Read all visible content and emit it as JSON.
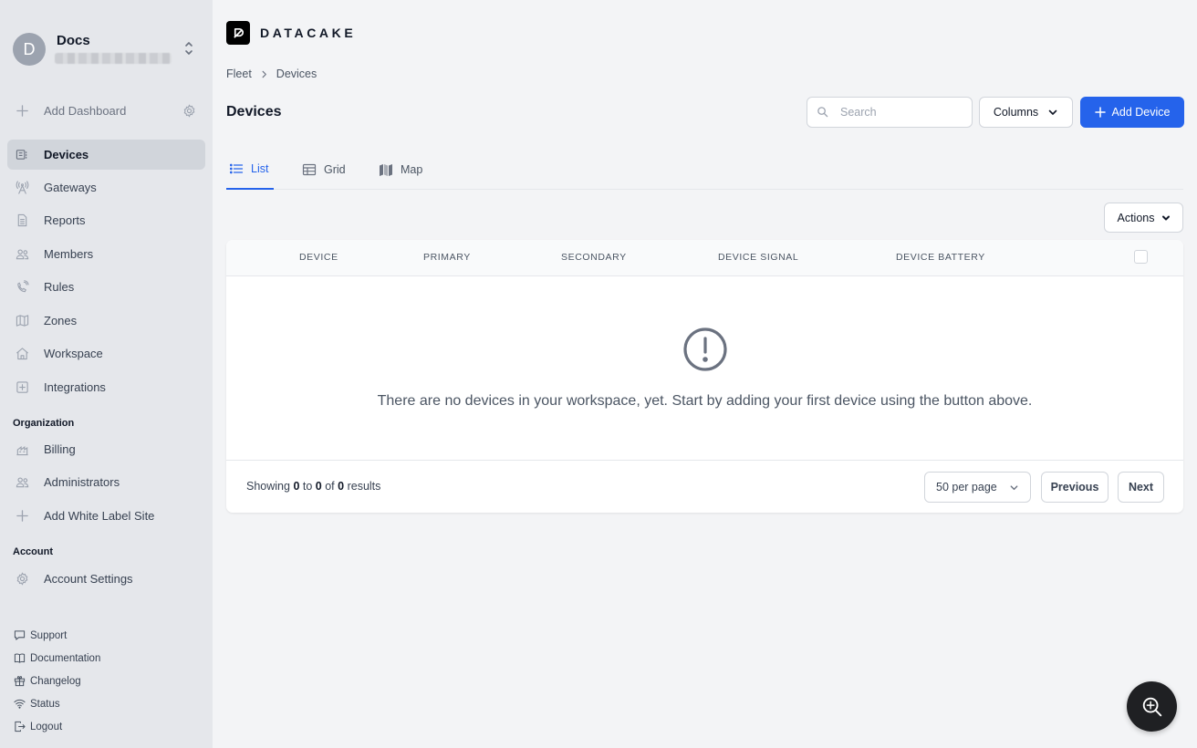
{
  "workspace": {
    "avatar_letter": "D",
    "name": "Docs"
  },
  "sidebar": {
    "add_dashboard": "Add Dashboard",
    "items": [
      {
        "label": "Devices",
        "icon": "device-icon"
      },
      {
        "label": "Gateways",
        "icon": "antenna-icon"
      },
      {
        "label": "Reports",
        "icon": "document-icon"
      },
      {
        "label": "Members",
        "icon": "users-icon"
      },
      {
        "label": "Rules",
        "icon": "phone-signal-icon"
      },
      {
        "label": "Zones",
        "icon": "map-icon"
      },
      {
        "label": "Workspace",
        "icon": "house-icon"
      },
      {
        "label": "Integrations",
        "icon": "plus-square-icon"
      }
    ],
    "organization_title": "Organization",
    "organization_items": [
      {
        "label": "Billing",
        "icon": "billing-icon"
      },
      {
        "label": "Administrators",
        "icon": "users-icon"
      },
      {
        "label": "Add White Label Site",
        "icon": "plus-icon"
      }
    ],
    "account_title": "Account",
    "account_items": [
      {
        "label": "Account Settings",
        "icon": "gear-icon"
      }
    ],
    "footer": [
      {
        "label": "Support",
        "icon": "chat-icon"
      },
      {
        "label": "Documentation",
        "icon": "book-icon"
      },
      {
        "label": "Changelog",
        "icon": "gift-icon"
      },
      {
        "label": "Status",
        "icon": "wifi-icon"
      },
      {
        "label": "Logout",
        "icon": "logout-icon"
      }
    ]
  },
  "brand": {
    "name": "DATACAKE"
  },
  "breadcrumb": {
    "parent": "Fleet",
    "current": "Devices"
  },
  "page": {
    "title": "Devices"
  },
  "search": {
    "placeholder": "Search"
  },
  "toolbar": {
    "columns_label": "Columns",
    "add_label": "Add Device",
    "actions_label": "Actions"
  },
  "tabs": [
    {
      "label": "List",
      "active": true
    },
    {
      "label": "Grid",
      "active": false
    },
    {
      "label": "Map",
      "active": false
    }
  ],
  "table": {
    "columns": [
      "DEVICE",
      "PRIMARY",
      "SECONDARY",
      "DEVICE SIGNAL",
      "DEVICE BATTERY"
    ],
    "empty_message": "There are no devices in your workspace, yet. Start by adding your first device using the button above."
  },
  "pagination": {
    "showing": "Showing",
    "from": "0",
    "to_word": "to",
    "to": "0",
    "of_word": "of",
    "total": "0",
    "results_word": "results",
    "per_page": "50 per page",
    "previous": "Previous",
    "next": "Next"
  },
  "colors": {
    "primary": "#2563eb",
    "sidebar_bg": "#e5e7eb",
    "page_bg": "#f3f4f6"
  }
}
